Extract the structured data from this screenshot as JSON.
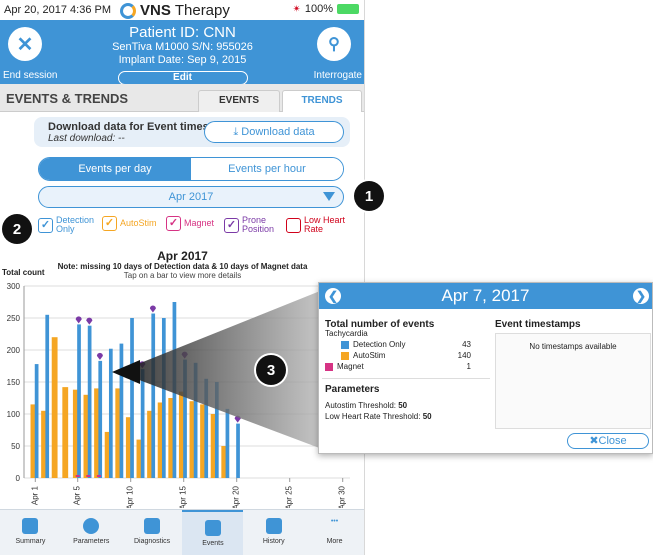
{
  "status": {
    "time": "Apr 20, 2017  4:36 PM",
    "brand_bold": "VNS",
    "brand_rest": "Therapy",
    "battery": "100%"
  },
  "header": {
    "patient_id": "Patient ID: CNN",
    "device": "SenTiva M1000 S/N: 955026",
    "implant": "Implant Date: Sep 9, 2015",
    "edit_label": "Edit",
    "end_session_label": "End session",
    "interrogate_label": "Interrogate"
  },
  "section": {
    "title": "EVENTS & TRENDS",
    "tabs": [
      {
        "label": "EVENTS"
      },
      {
        "label": "TRENDS"
      }
    ]
  },
  "download": {
    "title": "Download data for Event timestamps",
    "last": "Last download: --",
    "button_label": "Download data"
  },
  "toggle": {
    "options": [
      {
        "label": "Events per day"
      },
      {
        "label": "Events per hour"
      }
    ],
    "selected": "Events per day"
  },
  "month_select": {
    "value": "Apr 2017"
  },
  "filters": [
    {
      "label": "Detection\nOnly",
      "color": "#3f94d6",
      "checked": true
    },
    {
      "label": "AutoStim",
      "color": "#f5a623",
      "checked": true
    },
    {
      "label": "Magnet",
      "color": "#d63384",
      "checked": true
    },
    {
      "label": "Prone\nPosition",
      "color": "#7b3aa6",
      "checked": true
    },
    {
      "label": "Low Heart\nRate",
      "color": "#d0021b",
      "checked": false
    }
  ],
  "badges": [
    "1",
    "2",
    "3"
  ],
  "chart": {
    "title": "Apr 2017",
    "note": "Note: missing 10 days of Detection data & 10 days of Magnet data",
    "hint": "Tap on a bar to view more details",
    "ylabel": "Total count"
  },
  "chart_data": {
    "type": "bar",
    "ylabel": "Total count",
    "ylim": [
      0,
      300
    ],
    "yticks": [
      0,
      50,
      100,
      150,
      200,
      250,
      300
    ],
    "xticks": [
      "Apr 1",
      "Apr 5",
      "Apr 10",
      "Apr 15",
      "Apr 20",
      "Apr 25",
      "Apr 30"
    ],
    "categories": [
      "Apr 1",
      "Apr 2",
      "Apr 3",
      "Apr 4",
      "Apr 5",
      "Apr 6",
      "Apr 7",
      "Apr 8",
      "Apr 9",
      "Apr 10",
      "Apr 11",
      "Apr 12",
      "Apr 13",
      "Apr 14",
      "Apr 15",
      "Apr 16",
      "Apr 17",
      "Apr 18",
      "Apr 19",
      "Apr 20"
    ],
    "series": [
      {
        "name": "AutoStim",
        "color": "#f5a623",
        "values": [
          115,
          105,
          220,
          142,
          138,
          130,
          140,
          72,
          140,
          95,
          60,
          105,
          118,
          125,
          135,
          120,
          115,
          100,
          50,
          0
        ]
      },
      {
        "name": "Detection Only",
        "color": "#3f94d6",
        "values": [
          63,
          150,
          0,
          0,
          102,
          108,
          43,
          130,
          70,
          155,
          110,
          152,
          132,
          150,
          50,
          60,
          40,
          50,
          58,
          85
        ]
      },
      {
        "name": "Magnet",
        "color": "#d63384",
        "values": [
          0,
          0,
          0,
          0,
          1,
          1,
          1,
          0,
          0,
          0,
          0,
          0,
          0,
          0,
          0,
          0,
          0,
          0,
          0,
          0
        ]
      },
      {
        "name": "Prone Position",
        "color": "#7b3aa6",
        "values": [
          0,
          0,
          0,
          0,
          1,
          1,
          1,
          0,
          0,
          0,
          1,
          1,
          0,
          0,
          1,
          0,
          0,
          0,
          0,
          1
        ]
      }
    ]
  },
  "popup": {
    "date": "Apr 7, 2017",
    "total_title": "Total number of events",
    "category": "Tachycardia",
    "rows": [
      {
        "label": "Detection Only",
        "value": "43",
        "color": "#3f94d6"
      },
      {
        "label": "AutoStim",
        "value": "140",
        "color": "#f5a623"
      },
      {
        "label": "Magnet",
        "value": "1",
        "color": "#d63384"
      }
    ],
    "params_title": "Parameters",
    "params": [
      {
        "label": "Autostim Threshold:",
        "value": "50"
      },
      {
        "label": "Low Heart Rate Threshold:",
        "value": "50"
      }
    ],
    "timestamps_title": "Event timestamps",
    "timestamps_empty": "No timestamps available",
    "close_label": "Close"
  },
  "nav": [
    {
      "label": "Summary"
    },
    {
      "label": "Parameters"
    },
    {
      "label": "Diagnostics"
    },
    {
      "label": "Events"
    },
    {
      "label": "History"
    },
    {
      "label": "More"
    }
  ]
}
